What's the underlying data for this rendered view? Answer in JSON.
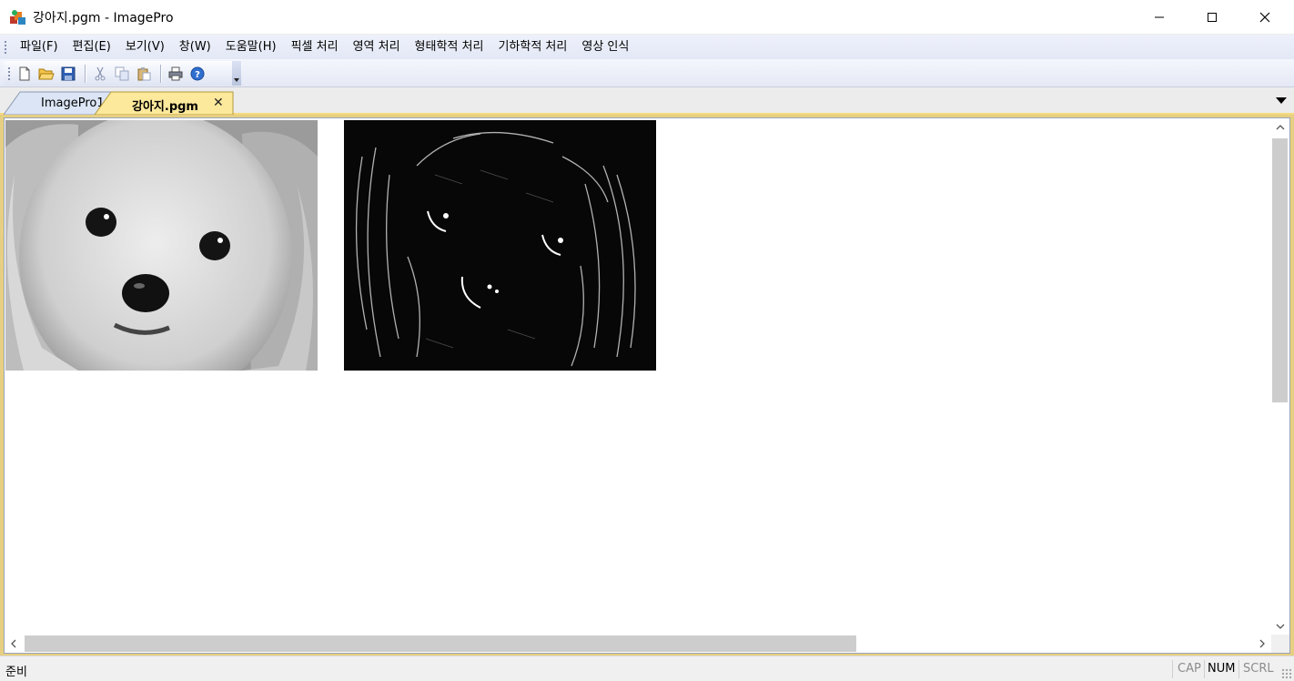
{
  "window": {
    "title": "강아지.pgm - ImagePro",
    "app_icon": "imagepro-app-icon"
  },
  "menu": [
    {
      "label": "파일(F)"
    },
    {
      "label": "편집(E)"
    },
    {
      "label": "보기(V)"
    },
    {
      "label": "창(W)"
    },
    {
      "label": "도움말(H)"
    },
    {
      "label": "픽셀 처리"
    },
    {
      "label": "영역 처리"
    },
    {
      "label": "형태학적 처리"
    },
    {
      "label": "기하학적 처리"
    },
    {
      "label": "영상 인식"
    }
  ],
  "toolbar": {
    "buttons": [
      "new-file-icon",
      "open-folder-icon",
      "save-icon",
      "cut-icon",
      "copy-icon",
      "paste-icon",
      "print-icon",
      "help-icon"
    ]
  },
  "tabs": [
    {
      "label": "ImagePro1",
      "active": false
    },
    {
      "label": "강아지.pgm",
      "active": true,
      "close": "✕"
    }
  ],
  "status": {
    "text": "준비",
    "indicators": [
      {
        "label": "CAP",
        "on": false
      },
      {
        "label": "NUM",
        "on": true
      },
      {
        "label": "SCRL",
        "on": false
      }
    ]
  },
  "colors": {
    "active_tab": "#fde99c",
    "document_frame": "#e6cf82",
    "menu_bg": "#e9edf8"
  }
}
